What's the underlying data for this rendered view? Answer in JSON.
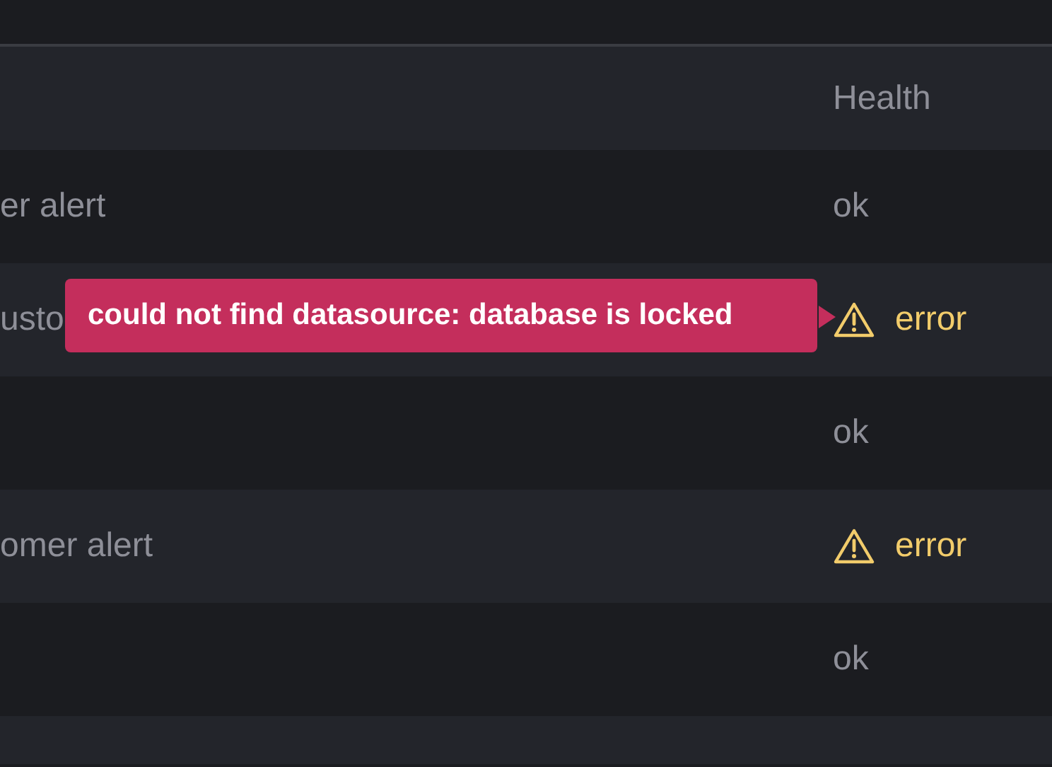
{
  "table": {
    "columns": [
      "Health"
    ],
    "rows": [
      {
        "name": "er alert",
        "kind": "plain",
        "health": "ok"
      },
      {
        "name": "usto",
        "kind": "warning",
        "health": "error",
        "tooltip": "could not find datasource: database is locked"
      },
      {
        "kind": "plain",
        "health": "ok"
      },
      {
        "name": "omer alert",
        "kind": "warning",
        "health": "error"
      },
      {
        "kind": "plain",
        "health": "ok"
      },
      {}
    ]
  }
}
